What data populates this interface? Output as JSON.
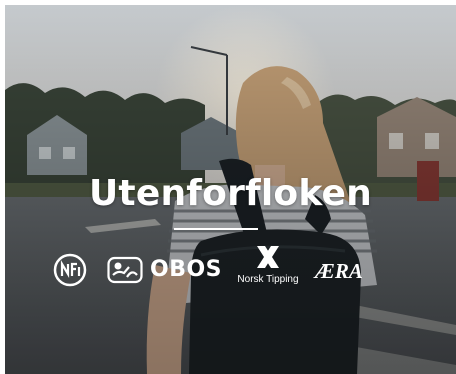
{
  "banner": {
    "title": "Utenforfloken",
    "background_description_colors": {
      "sky": "#d9dde0",
      "trees": "#3e4a3b",
      "road": "#5a5f63",
      "hair": "#c9a57a",
      "backpack": "#1c2226"
    }
  },
  "logos": {
    "nfr": {
      "icon": "nfr-circle-logo-icon"
    },
    "obos": {
      "icon": "obos-figure-logo-icon",
      "label": "OBOS"
    },
    "norsk_tipping": {
      "icon": "norsk-tipping-x-logo-icon",
      "label": "Norsk Tipping"
    },
    "era": {
      "icon": "aera-wordmark-logo-icon",
      "label": "ÆRA"
    }
  }
}
